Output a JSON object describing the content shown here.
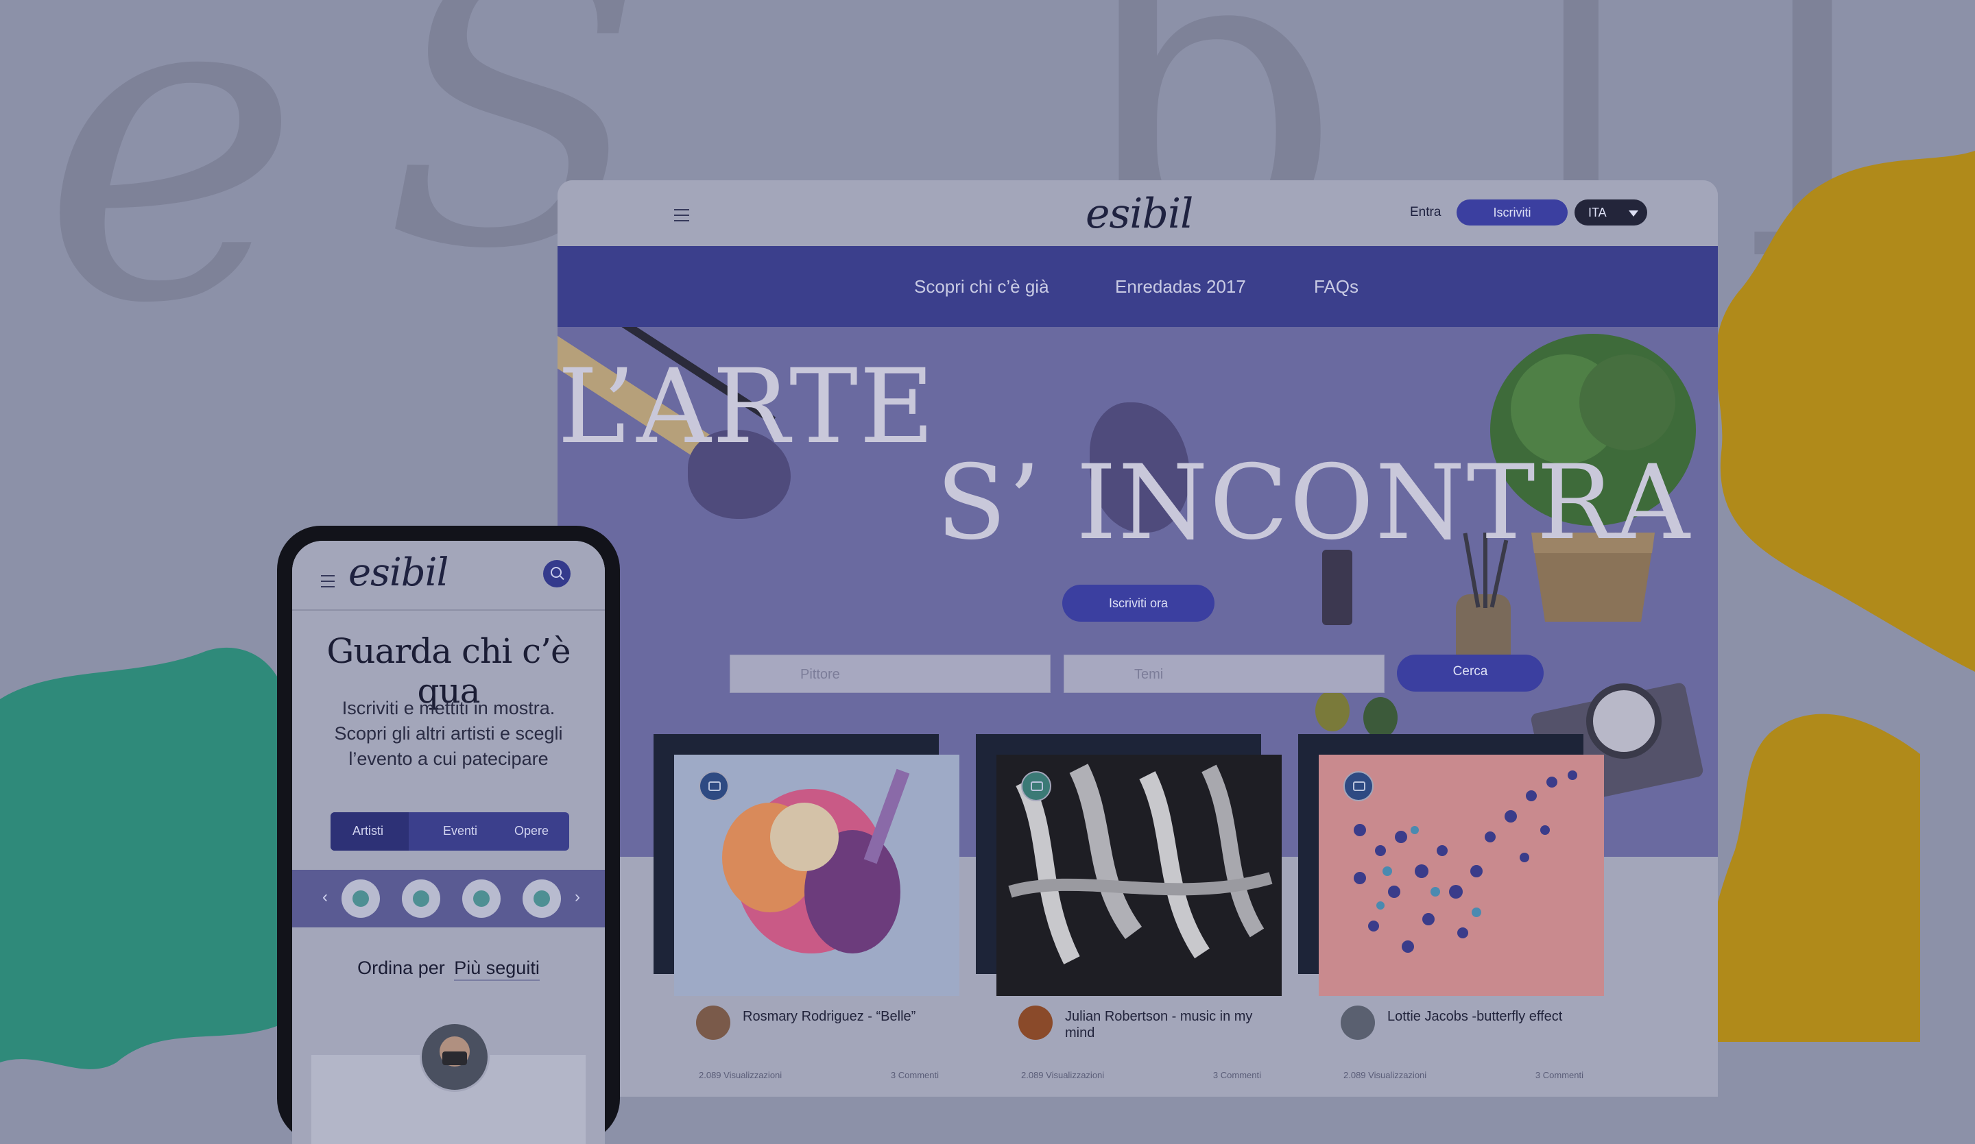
{
  "desktop": {
    "header": {
      "logo": "esibil",
      "login_label": "Entra",
      "signup_label": "Iscriviti",
      "language": "ITA"
    },
    "nav": {
      "items": [
        "Scopri chi c’è già",
        "Enredadas 2017",
        "FAQs"
      ]
    },
    "hero": {
      "title_line1": "L’ARTE",
      "title_line2": "S’ INCONTRA",
      "cta_label": "Iscriviti ora",
      "search": {
        "artist_placeholder": "Pittore",
        "theme_placeholder": "Temi",
        "button_label": "Cerca"
      }
    },
    "cards": [
      {
        "title": "Rosmary Rodriguez - “Belle”",
        "views": "2.089 Visualizzazioni",
        "comments": "3 Commenti",
        "category_icon": "camera-icon"
      },
      {
        "title": "Julian Robertson - music in my mind",
        "views": "2.089 Visualizzazioni",
        "comments": "3 Commenti",
        "category_icon": "camera-icon"
      },
      {
        "title": "Lottie Jacobs -butterfly effect",
        "views": "2.089 Visualizzazioni",
        "comments": "3 Commenti",
        "category_icon": "camera-icon"
      }
    ]
  },
  "mobile": {
    "logo": "esibil",
    "heading": "Guarda chi c’è qua",
    "subtitle": "Iscriviti e mettiti in mostra. Scopri gli altri artisti e scegli l’evento a cui patecipare",
    "tabs": [
      "Artisti",
      "Eventi",
      "Opere"
    ],
    "active_tab": "Artisti",
    "categories": [
      "camera-icon",
      "vase-icon",
      "music-icon",
      "palette-icon"
    ],
    "order_label": "Ordina per",
    "order_value": "Più seguiti"
  },
  "colors": {
    "primary": "#3b3f8c",
    "hero_bg": "#6a6aa0",
    "accent_teal": "#2f8a7a",
    "accent_yellow": "#b08a1a",
    "overlay": "#8c91a8"
  }
}
